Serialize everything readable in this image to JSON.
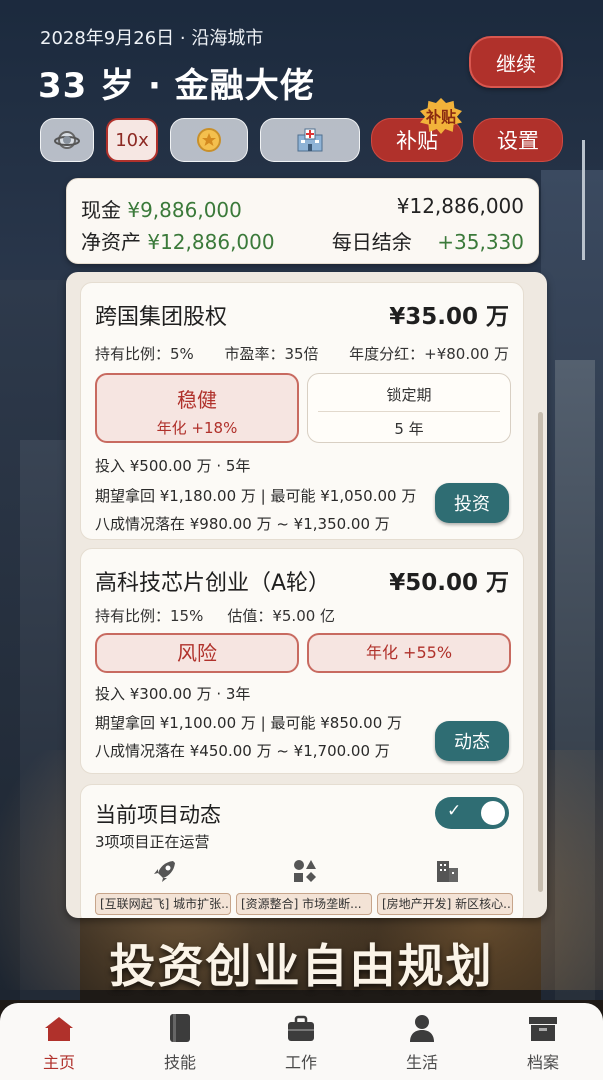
{
  "header": {
    "date_line": "2028年9月26日 · 沿海城市",
    "title": "33 岁 · 金融大佬",
    "continue_label": "继续"
  },
  "toolbar": {
    "speed_label": "10x",
    "subsidy_label": "补贴",
    "subsidy_badge": "补贴",
    "settings_label": "设置"
  },
  "summary": {
    "cash_label": "现金",
    "cash_value": "¥9,886,000",
    "total_value": "¥12,886,000",
    "net_label": "净资产",
    "net_value": "¥12,886,000",
    "daily_label": "每日结余",
    "daily_value": "+35,330"
  },
  "investments": [
    {
      "title": "跨国集团股权",
      "amount": "¥35.00 万",
      "meta": [
        "持有比例：5%",
        "市盈率：35倍",
        "年度分红：+¥80.00 万"
      ],
      "tag_main": "稳健",
      "tag_sub": "年化 +18%",
      "lock_label": "锁定期",
      "lock_value": "5 年",
      "line1": "投入 ¥500.00 万 · 5年",
      "line2": "期望拿回 ¥1,180.00 万 | 最可能 ¥1,050.00 万",
      "line3": "八成情况落在 ¥980.00 万 ~ ¥1,350.00 万",
      "button": "投资"
    },
    {
      "title": "高科技芯片创业（A轮）",
      "amount": "¥50.00 万",
      "meta": [
        "持有比例：15%",
        "估值：¥5.00 亿"
      ],
      "tag_main": "风险",
      "tag_sub": "年化 +55%",
      "line1": "投入 ¥300.00 万 · 3年",
      "line2": "期望拿回 ¥1,100.00 万 | 最可能 ¥850.00 万",
      "line3": "八成情况落在 ¥450.00 万 ~ ¥1,700.00 万",
      "button": "动态"
    }
  ],
  "project_feed": {
    "title": "当前项目动态",
    "subtitle": "3项项目正在运营",
    "items": [
      {
        "icon": "rocket-icon",
        "text": "[互联网起飞] 城市扩张..."
      },
      {
        "icon": "shapes-icon",
        "text": "[资源整合] 市场垄断..."
      },
      {
        "icon": "building-icon",
        "text": "[房地产开发] 新区核心..."
      }
    ],
    "toggle_on": true
  },
  "slogan": "投资创业自由规划",
  "tabs": [
    {
      "label": "主页",
      "icon": "home-icon",
      "active": true
    },
    {
      "label": "技能",
      "icon": "book-icon",
      "active": false
    },
    {
      "label": "工作",
      "icon": "briefcase-icon",
      "active": false
    },
    {
      "label": "生活",
      "icon": "person-icon",
      "active": false
    },
    {
      "label": "档案",
      "icon": "archive-icon",
      "active": false
    }
  ],
  "colors": {
    "brand_red": "#b0312b",
    "teal": "#2f6d73",
    "positive_green": "#3b7a3a",
    "badge_gold": "#f2b23a"
  }
}
